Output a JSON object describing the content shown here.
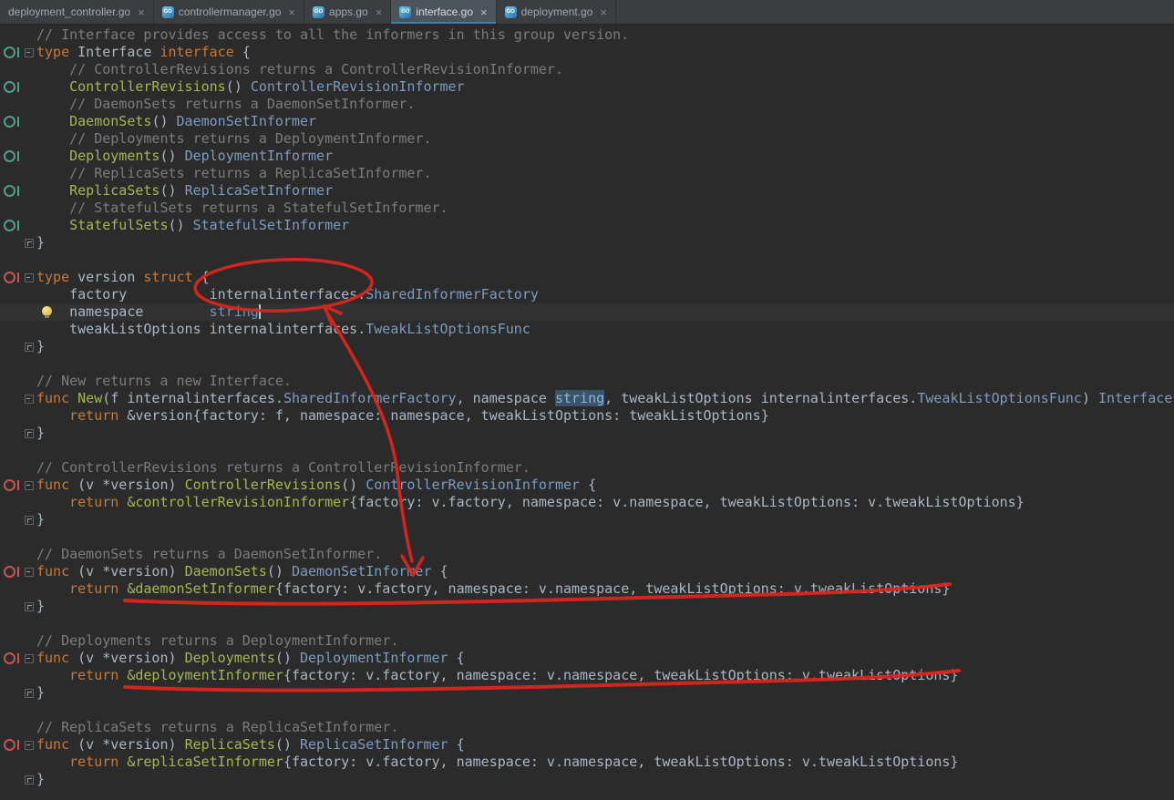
{
  "icons": {
    "go_file_label": "GO",
    "tab_close": "×",
    "implemented_marker": "green-circle-with-bar",
    "overridden_marker": "red-circle-with-bar",
    "fold_collapse": "square-minus",
    "fold_end": "square-corner",
    "intention_bulb": "yellow-bulb"
  },
  "tabs": [
    {
      "label": "deployment_controller.go",
      "icon": false,
      "active": false
    },
    {
      "label": "controllermanager.go",
      "icon": true,
      "active": false
    },
    {
      "label": "apps.go",
      "icon": true,
      "active": false
    },
    {
      "label": "interface.go",
      "icon": true,
      "active": true
    },
    {
      "label": "deployment.go",
      "icon": true,
      "active": false
    }
  ],
  "annotations": {
    "color": "#E0251C",
    "items": [
      "ellipse around internalinterfaces in version struct",
      "arrow from internalinterfaces down to DaemonSets return",
      "underline under &daemonSetInformer return line",
      "underline under &deploymentInformer return line"
    ]
  },
  "editor": {
    "lines": [
      {
        "t": [
          [
            "cm",
            "// Interface provides access to all the informers in this group version."
          ]
        ]
      },
      {
        "g": "impl",
        "f": "open",
        "t": [
          [
            "kw",
            "type"
          ],
          [
            "pl",
            " Interface "
          ],
          [
            "kw",
            "interface"
          ],
          [
            "pl",
            " {"
          ]
        ]
      },
      {
        "t": [
          [
            "cm",
            "    // ControllerRevisions returns a ControllerRevisionInformer."
          ]
        ]
      },
      {
        "g": "impl",
        "t": [
          [
            "pl",
            "    "
          ],
          [
            "fn",
            "ControllerRevisions"
          ],
          [
            "pl",
            "() "
          ],
          [
            "ty",
            "ControllerRevisionInformer"
          ]
        ]
      },
      {
        "t": [
          [
            "cm",
            "    // DaemonSets returns a DaemonSetInformer."
          ]
        ]
      },
      {
        "g": "impl",
        "t": [
          [
            "pl",
            "    "
          ],
          [
            "fn",
            "DaemonSets"
          ],
          [
            "pl",
            "() "
          ],
          [
            "ty",
            "DaemonSetInformer"
          ]
        ]
      },
      {
        "t": [
          [
            "cm",
            "    // Deployments returns a DeploymentInformer."
          ]
        ]
      },
      {
        "g": "impl",
        "t": [
          [
            "pl",
            "    "
          ],
          [
            "fn",
            "Deployments"
          ],
          [
            "pl",
            "() "
          ],
          [
            "ty",
            "DeploymentInformer"
          ]
        ]
      },
      {
        "t": [
          [
            "cm",
            "    // ReplicaSets returns a ReplicaSetInformer."
          ]
        ]
      },
      {
        "g": "impl",
        "t": [
          [
            "pl",
            "    "
          ],
          [
            "fn",
            "ReplicaSets"
          ],
          [
            "pl",
            "() "
          ],
          [
            "ty",
            "ReplicaSetInformer"
          ]
        ]
      },
      {
        "t": [
          [
            "cm",
            "    // StatefulSets returns a StatefulSetInformer."
          ]
        ]
      },
      {
        "g": "impl",
        "t": [
          [
            "pl",
            "    "
          ],
          [
            "fn",
            "StatefulSets"
          ],
          [
            "pl",
            "() "
          ],
          [
            "ty",
            "StatefulSetInformer"
          ]
        ]
      },
      {
        "f": "close",
        "t": [
          [
            "pl",
            "}"
          ]
        ]
      },
      {
        "t": []
      },
      {
        "g": "over",
        "f": "open",
        "t": [
          [
            "kw",
            "type"
          ],
          [
            "pl",
            " version "
          ],
          [
            "kw",
            "struct"
          ],
          [
            "pl",
            " {"
          ]
        ]
      },
      {
        "t": [
          [
            "pl",
            "    factory          internalinterfaces."
          ],
          [
            "ty",
            "SharedInformerFactory"
          ]
        ]
      },
      {
        "cur": true,
        "bulb": true,
        "t": [
          [
            "pl",
            "    namespace        "
          ],
          [
            "st",
            "string"
          ],
          [
            "caret",
            ""
          ]
        ]
      },
      {
        "t": [
          [
            "pl",
            "    tweakListOptions internalinterfaces."
          ],
          [
            "ty",
            "TweakListOptionsFunc"
          ]
        ]
      },
      {
        "f": "close",
        "t": [
          [
            "pl",
            "}"
          ]
        ]
      },
      {
        "t": []
      },
      {
        "t": [
          [
            "cm",
            "// New returns a new Interface."
          ]
        ]
      },
      {
        "f": "open",
        "t": [
          [
            "kw",
            "func"
          ],
          [
            "pl",
            " "
          ],
          [
            "fn",
            "New"
          ],
          [
            "pl",
            "(f internalinterfaces."
          ],
          [
            "ty",
            "SharedInformerFactory"
          ],
          [
            "pl",
            ", namespace "
          ],
          [
            "sth",
            "string"
          ],
          [
            "pl",
            ", tweakListOptions internalinterfaces."
          ],
          [
            "ty",
            "TweakListOptionsFunc"
          ],
          [
            "pl",
            ") "
          ],
          [
            "ty",
            "Interface"
          ],
          [
            "pl",
            " {"
          ]
        ]
      },
      {
        "t": [
          [
            "pl",
            "    "
          ],
          [
            "kw",
            "return"
          ],
          [
            "pl",
            " &version{factory: f, namespace: namespace, tweakListOptions: tweakListOptions}"
          ]
        ]
      },
      {
        "f": "close",
        "t": [
          [
            "pl",
            "}"
          ]
        ]
      },
      {
        "t": []
      },
      {
        "t": [
          [
            "cm",
            "// ControllerRevisions returns a ControllerRevisionInformer."
          ]
        ]
      },
      {
        "g": "over",
        "f": "open",
        "t": [
          [
            "kw",
            "func"
          ],
          [
            "pl",
            " (v *version) "
          ],
          [
            "fn",
            "ControllerRevisions"
          ],
          [
            "pl",
            "() "
          ],
          [
            "ty",
            "ControllerRevisionInformer"
          ],
          [
            "pl",
            " {"
          ]
        ]
      },
      {
        "t": [
          [
            "pl",
            "    "
          ],
          [
            "kw",
            "return"
          ],
          [
            "pl",
            " "
          ],
          [
            "fn",
            "&controllerRevisionInformer"
          ],
          [
            "pl",
            "{factory: v.factory, namespace: v.namespace, tweakListOptions: v.tweakListOptions}"
          ]
        ]
      },
      {
        "f": "close",
        "t": [
          [
            "pl",
            "}"
          ]
        ]
      },
      {
        "t": []
      },
      {
        "t": [
          [
            "cm",
            "// DaemonSets returns a DaemonSetInformer."
          ]
        ]
      },
      {
        "g": "over",
        "f": "open",
        "t": [
          [
            "kw",
            "func"
          ],
          [
            "pl",
            " (v *version) "
          ],
          [
            "fn",
            "DaemonSets"
          ],
          [
            "pl",
            "() "
          ],
          [
            "ty",
            "DaemonSetInformer"
          ],
          [
            "pl",
            " {"
          ]
        ]
      },
      {
        "t": [
          [
            "pl",
            "    "
          ],
          [
            "kw",
            "return"
          ],
          [
            "pl",
            " "
          ],
          [
            "fn",
            "&daemonSetInformer"
          ],
          [
            "pl",
            "{factory: v.factory, namespace: v.namespace, tweakListOptions: v.tweakListOptions}"
          ]
        ]
      },
      {
        "f": "close",
        "t": [
          [
            "pl",
            "}"
          ]
        ]
      },
      {
        "t": []
      },
      {
        "t": [
          [
            "cm",
            "// Deployments returns a DeploymentInformer."
          ]
        ]
      },
      {
        "g": "over",
        "f": "open",
        "t": [
          [
            "kw",
            "func"
          ],
          [
            "pl",
            " (v *version) "
          ],
          [
            "fn",
            "Deployments"
          ],
          [
            "pl",
            "() "
          ],
          [
            "ty",
            "DeploymentInformer"
          ],
          [
            "pl",
            " {"
          ]
        ]
      },
      {
        "t": [
          [
            "pl",
            "    "
          ],
          [
            "kw",
            "return"
          ],
          [
            "pl",
            " "
          ],
          [
            "fn",
            "&deploymentInformer"
          ],
          [
            "pl",
            "{factory: v.factory, namespace: v.namespace, tweakListOptions: v.tweakListOptions}"
          ]
        ]
      },
      {
        "f": "close",
        "t": [
          [
            "pl",
            "}"
          ]
        ]
      },
      {
        "t": []
      },
      {
        "t": [
          [
            "cm",
            "// ReplicaSets returns a ReplicaSetInformer."
          ]
        ]
      },
      {
        "g": "over",
        "f": "open",
        "t": [
          [
            "kw",
            "func"
          ],
          [
            "pl",
            " (v *version) "
          ],
          [
            "fn",
            "ReplicaSets"
          ],
          [
            "pl",
            "() "
          ],
          [
            "ty",
            "ReplicaSetInformer"
          ],
          [
            "pl",
            " {"
          ]
        ]
      },
      {
        "t": [
          [
            "pl",
            "    "
          ],
          [
            "kw",
            "return"
          ],
          [
            "pl",
            " "
          ],
          [
            "fn",
            "&replicaSetInformer"
          ],
          [
            "pl",
            "{factory: v.factory, namespace: v.namespace, tweakListOptions: v.tweakListOptions}"
          ]
        ]
      },
      {
        "f": "close",
        "t": [
          [
            "pl",
            "}"
          ]
        ]
      }
    ]
  }
}
